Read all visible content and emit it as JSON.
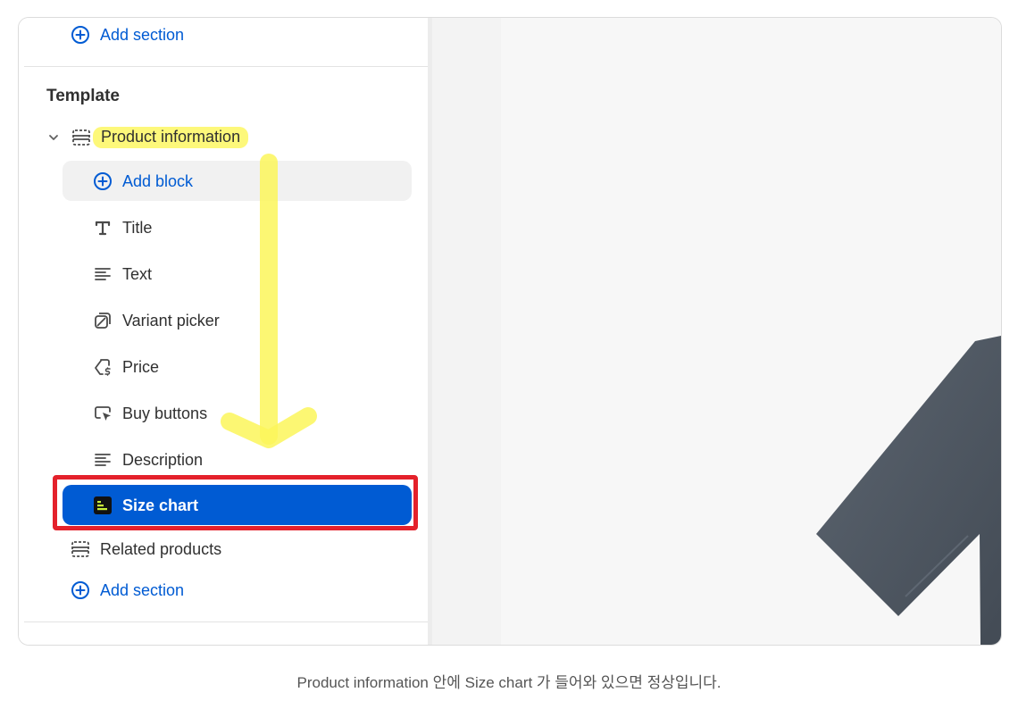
{
  "sidebar": {
    "add_section_top": "Add section",
    "template_heading": "Template",
    "product_information": "Product information",
    "add_block": "Add block",
    "blocks": {
      "title": "Title",
      "text": "Text",
      "variant_picker": "Variant picker",
      "price": "Price",
      "buy_buttons": "Buy buttons",
      "description": "Description",
      "size_chart": "Size chart"
    },
    "related_products": "Related products",
    "add_section_bottom": "Add section"
  },
  "caption": "Product information 안에 Size chart 가 들어와 있으면 정상입니다.",
  "colors": {
    "accent": "#005bd3",
    "highlight": "#fdf87a",
    "outline": "#e4212b",
    "preview_shape": "#4f5863"
  },
  "icons": {
    "add": "plus-circle-icon",
    "chevron": "chevron-down-icon",
    "section": "section-icon",
    "title": "text-title-icon",
    "text": "text-lines-icon",
    "variant": "variant-picker-icon",
    "price": "price-tag-icon",
    "buy": "cursor-click-icon",
    "description": "text-lines-icon",
    "size_chart": "size-chart-app-icon"
  }
}
